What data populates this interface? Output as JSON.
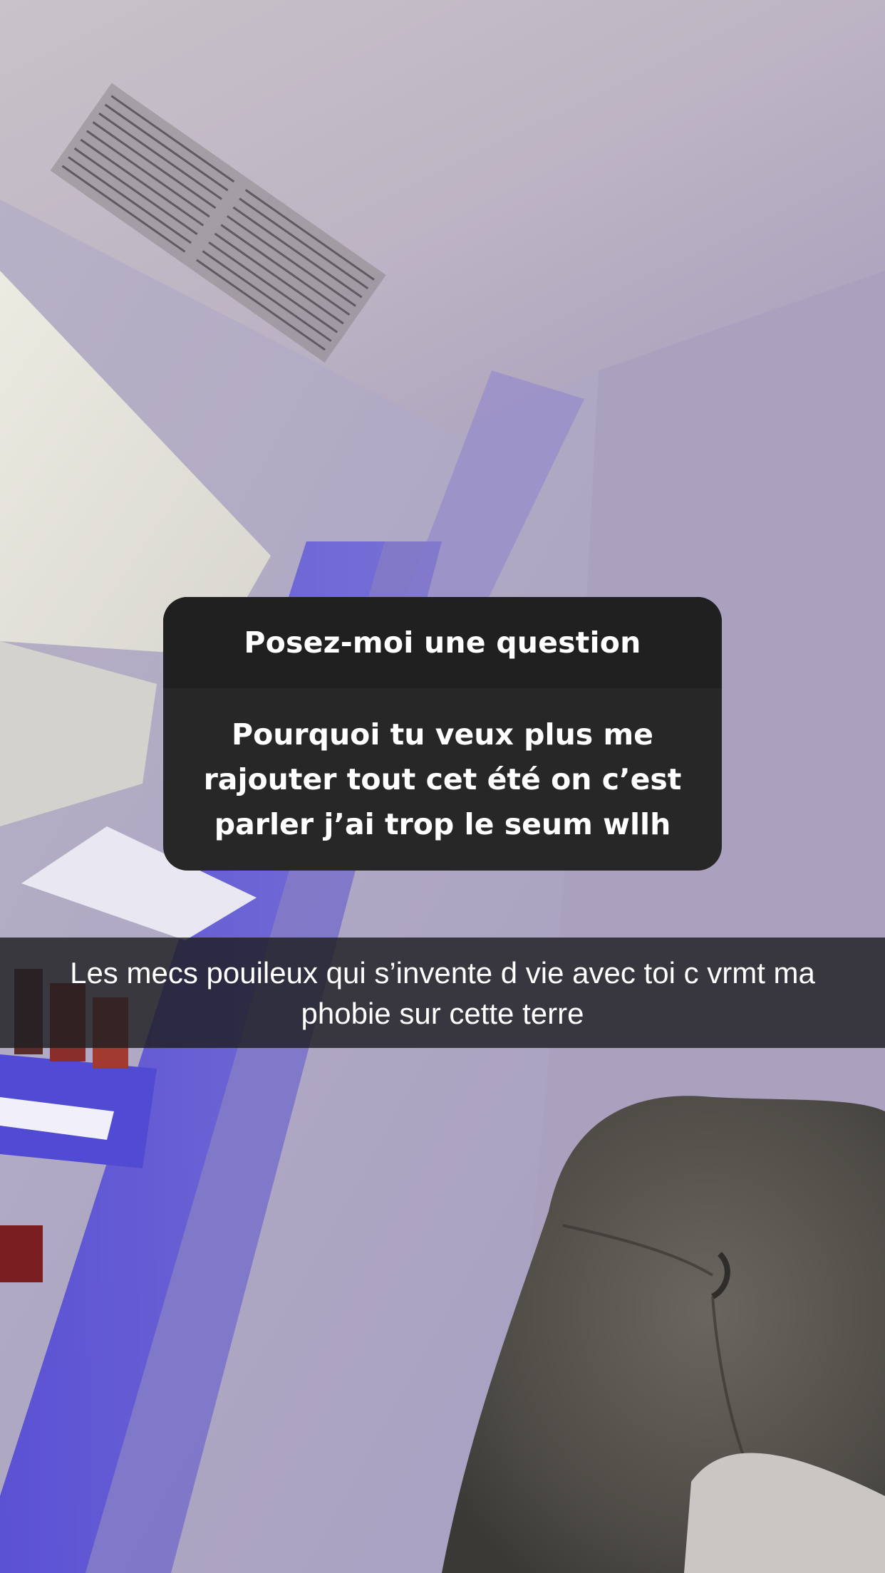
{
  "question_sticker": {
    "header": "Posez-moi une question",
    "question": "Pourquoi tu veux plus me rajouter tout cet été on c’est parler j’ai trop le seum wllh"
  },
  "caption": {
    "text": "Les mecs pouileux qui s’invente d vie avec toi c vrmt ma phobie sur cette terre"
  },
  "colors": {
    "sticker_header_bg": "#202020",
    "sticker_body_bg": "#272727",
    "caption_bg": "#1e1e22",
    "text": "#ffffff"
  }
}
